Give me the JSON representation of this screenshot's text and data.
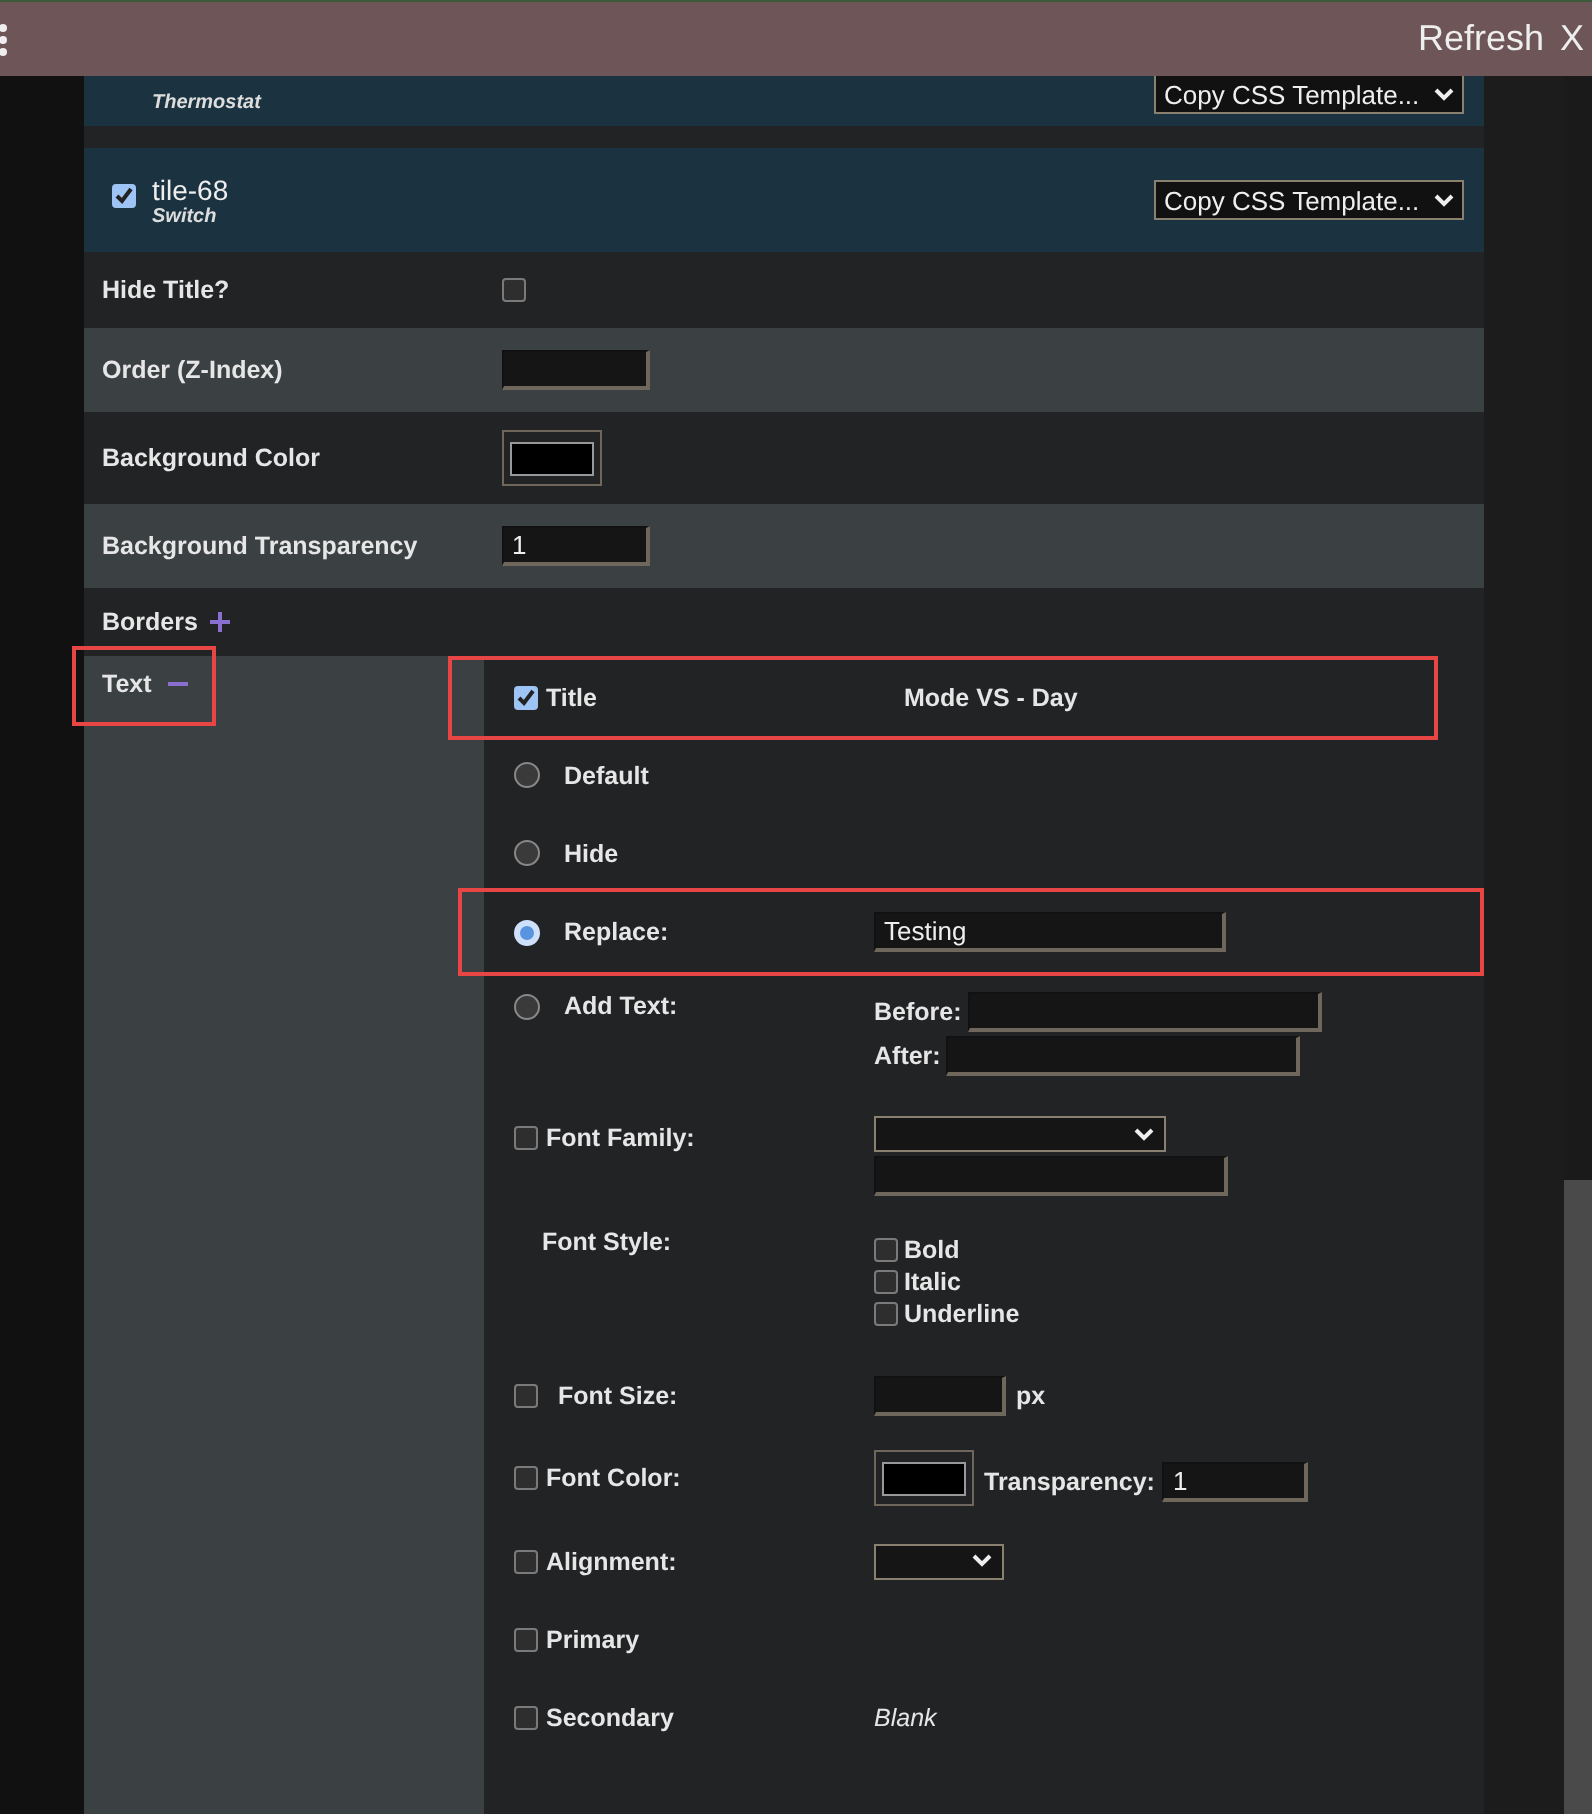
{
  "top_bar": {
    "actions": [
      "Refresh",
      "X"
    ]
  },
  "tiles": [
    {
      "subtitle": "Thermostat",
      "template_select": "Copy CSS Template..."
    },
    {
      "checked": true,
      "title": "tile-68",
      "subtitle": "Switch",
      "template_select": "Copy CSS Template..."
    }
  ],
  "settings": [
    {
      "kind": "checkbox",
      "label": "Hide Title?",
      "checked": false
    },
    {
      "kind": "input",
      "label": "Order (Z-Index)"
    },
    {
      "kind": "color",
      "label": "Background Color"
    },
    {
      "kind": "input",
      "label": "Background Transparency",
      "value": "1"
    },
    {
      "kind": "expander",
      "label": "Borders",
      "expanded": false
    }
  ],
  "text_section": {
    "label": "Text",
    "expanded": true,
    "highlighted": true,
    "title": {
      "checked": true,
      "label": "Title",
      "value": "Mode VS - Day",
      "highlighted": true
    },
    "options": [
      {
        "label": "Default",
        "selected": false,
        "highlighted": false
      },
      {
        "label": "Hide",
        "selected": false,
        "highlighted": false
      },
      {
        "label": "Replace:",
        "selected": true,
        "value": "Testing",
        "highlighted": true
      },
      {
        "label": "Add Text:",
        "selected": false,
        "highlighted": false,
        "before_label": "Before:",
        "after_label": "After:"
      }
    ],
    "font_family": {
      "checked": false,
      "label": "Font Family:"
    },
    "font_style": {
      "label": "Font Style:",
      "options": [
        {
          "label": "Bold",
          "checked": false
        },
        {
          "label": "Italic",
          "checked": false
        },
        {
          "label": "Underline",
          "checked": false
        }
      ]
    },
    "font_size": {
      "checked": false,
      "label": "Font Size:",
      "unit": "px"
    },
    "font_color": {
      "checked": false,
      "label": "Font Color:",
      "transparency_label": "Transparency:",
      "transparency": "1"
    },
    "alignment": {
      "checked": false,
      "label": "Alignment:"
    },
    "subitems": [
      {
        "label": "Primary",
        "checked": false
      },
      {
        "label": "Secondary",
        "checked": false,
        "value": "Blank"
      }
    ]
  }
}
